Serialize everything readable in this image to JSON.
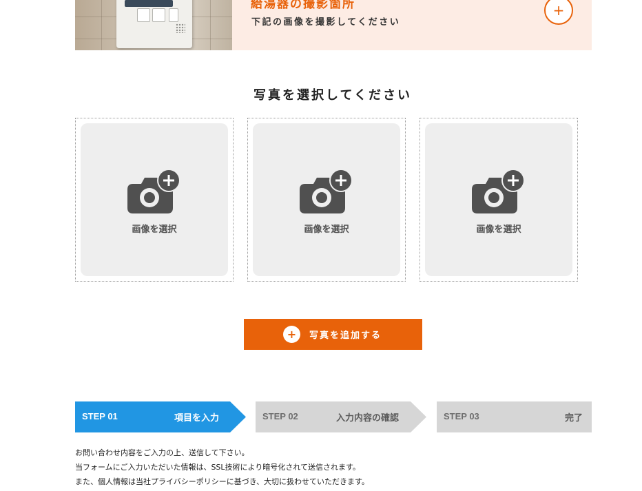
{
  "banner": {
    "title": "給湯器の撮影箇所",
    "subtitle": "下記の画像を撮影してください",
    "expand_symbol": "+"
  },
  "section": {
    "title": "写真を選択してください"
  },
  "photo_slots": [
    {
      "label": "画像を選択"
    },
    {
      "label": "画像を選択"
    },
    {
      "label": "画像を選択"
    }
  ],
  "add_button": {
    "label": "写真を追加する",
    "symbol": "+"
  },
  "steps": [
    {
      "number": "STEP 01",
      "label": "項目を入力",
      "state": "active"
    },
    {
      "number": "STEP 02",
      "label": "入力内容の確認",
      "state": "inactive"
    },
    {
      "number": "STEP 03",
      "label": "完了",
      "state": "inactive"
    }
  ],
  "notes": [
    "お問い合わせ内容をご入力の上、送信して下さい。",
    "当フォームにご入力いただいた情報は、SSL技術により暗号化されて送信されます。",
    "また、個人情報は当社プライバシーポリシーに基づき、大切に扱わせていただきます。"
  ],
  "colors": {
    "accent": "#e8620a",
    "banner_bg": "#fdece4",
    "step_active": "#2196e3",
    "step_inactive": "#d6d6d6",
    "slot_bg": "#eeeeee",
    "camera_icon": "#505050"
  },
  "icons": {
    "banner_toggle": "plus-circle-icon",
    "photo_slot": "camera-plus-icon",
    "add_button": "plus-circle-icon"
  }
}
